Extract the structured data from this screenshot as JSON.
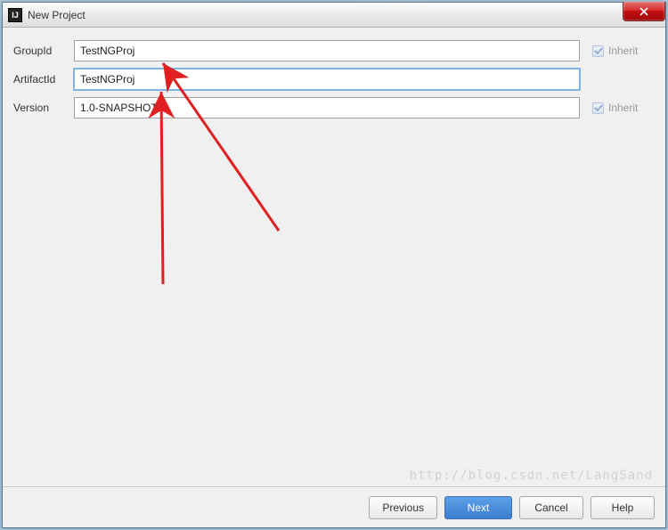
{
  "window": {
    "title": "New Project",
    "icon_text": "IJ"
  },
  "fields": {
    "groupId": {
      "label": "GroupId",
      "value": "TestNGProj",
      "inherit_label": "Inherit"
    },
    "artifactId": {
      "label": "ArtifactId",
      "value": "TestNGProj"
    },
    "version": {
      "label": "Version",
      "value": "1.0-SNAPSHOT",
      "inherit_label": "Inherit"
    }
  },
  "buttons": {
    "previous": "Previous",
    "next": "Next",
    "cancel": "Cancel",
    "help": "Help"
  },
  "watermark": "http://blog.csdn.net/LangSand"
}
